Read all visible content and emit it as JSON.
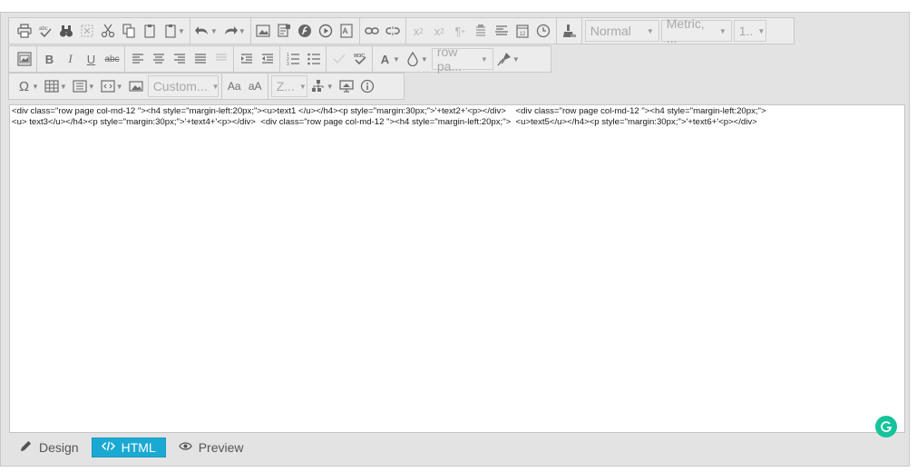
{
  "toolbar": {
    "row1": {
      "paragraph_format": "Normal",
      "font_family": "Metric, ...",
      "font_size": "1.."
    },
    "row2": {
      "bold": "B",
      "italic": "I",
      "underline": "U",
      "strikethrough": "abc",
      "font_color": "A",
      "css_class": "row pa..."
    },
    "row3": {
      "special_char": "Ω",
      "paragraph_style": "Custom...",
      "case_lower": "Aa",
      "case_upper": "aA",
      "zoom": "Z..."
    }
  },
  "editor": {
    "html_source": "<div class=\"row page col-md-12 \"><h4 style=\"margin-left:20px;\"><u>text1 </u></h4><p style=\"margin:30px;\">'+text2+'<p></div>    <div class=\"row page col-md-12 \"><h4 style=\"margin-left:20px;\">\n<u> text3</u></h4><p style=\"margin:30px;\">'+text4+'<p></div>  <div class=\"row page col-md-12 \"><h4 style=\"margin-left:20px;\">  <u>text5</u></h4><p style=\"margin:30px;\">'+text6+'<p></div>"
  },
  "modes": {
    "design": "Design",
    "html": "HTML",
    "preview": "Preview",
    "active": "HTML"
  },
  "colors": {
    "active_mode": "#1aa9d3",
    "grammarly": "#15c39a"
  }
}
